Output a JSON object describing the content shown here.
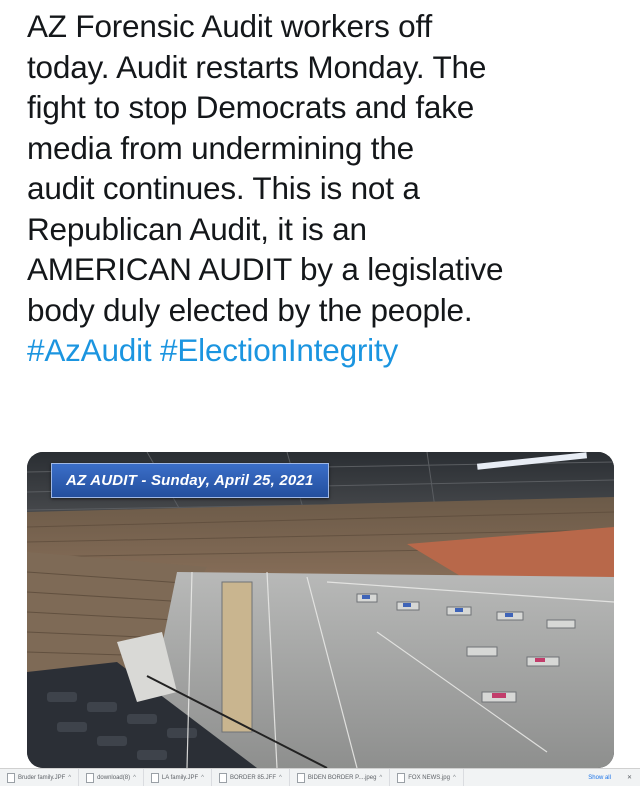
{
  "tweet": {
    "lines": [
      "AZ Forensic Audit workers off",
      "today. Audit restarts Monday. The",
      "fight to stop Democrats and fake",
      "media from undermining the",
      "audit continues. This is not a",
      "Republican Audit, it is an",
      "AMERICAN AUDIT by a legislative",
      "body duly elected by the people."
    ],
    "hashtags": [
      "#AzAudit",
      "#ElectionIntegrity"
    ]
  },
  "media": {
    "caption": "AZ AUDIT - Sunday, April 25, 2021"
  },
  "download_bar": {
    "items": [
      "Bruder family.JPF",
      "download(8)",
      "LA family.JPF",
      "BORDER 85.JFF",
      "BIDEN BORDER P....jpeg",
      "FOX NEWS.jpg"
    ],
    "show_all": "Show all",
    "close": "✕"
  },
  "colors": {
    "text": "#14171a",
    "hashtag": "#1b95e0",
    "banner": "#2d5db0"
  }
}
